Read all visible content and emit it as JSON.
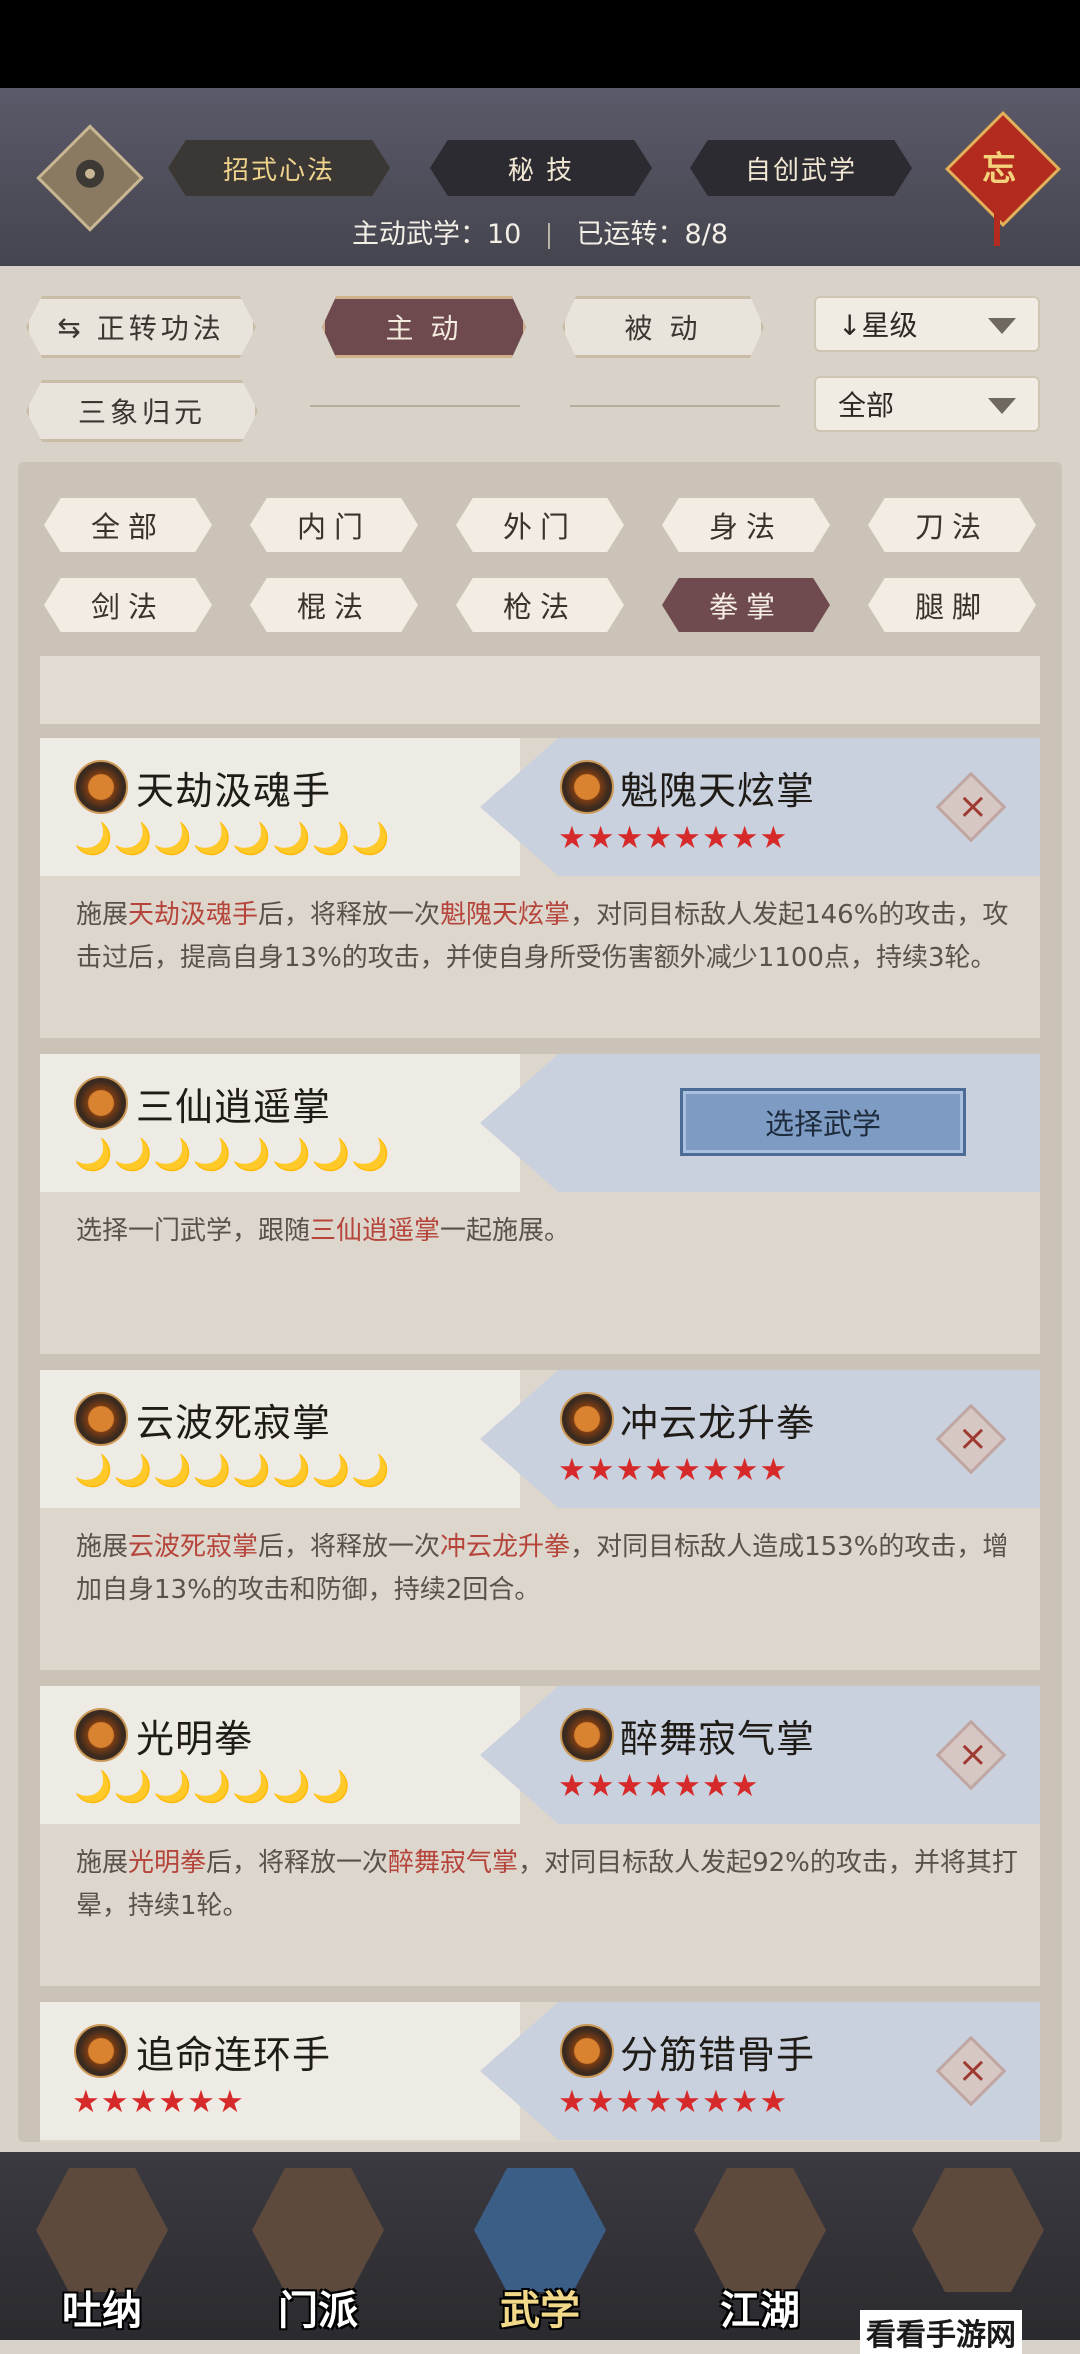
{
  "header": {
    "tabs": [
      {
        "label": "招式心法"
      },
      {
        "label": "秘 技"
      },
      {
        "label": "自创武学"
      }
    ],
    "talisman_char": "忘",
    "active_count_label": "主动武学：10",
    "operated_label": "已运转：8/8"
  },
  "toolbar": {
    "switch_label": "正转功法",
    "active_label": "主 动",
    "passive_label": "被 动",
    "sort_select": "↓星级",
    "sanxiang_label": "三象归元",
    "filter_select": "全部"
  },
  "categories": {
    "row1": [
      "全部",
      "内门",
      "外门",
      "身法",
      "刀法"
    ],
    "row2": [
      "剑法",
      "棍法",
      "枪法",
      "拳掌",
      "腿脚"
    ]
  },
  "cards": [
    {
      "left_name": "天劫汲魂手",
      "left_moons": "🌙🌙🌙🌙🌙🌙🌙🌙",
      "right_name": "魁隗天炫掌",
      "right_stars": "★★★★★★★★",
      "desc_a": "施展",
      "desc_hl1": "天劫汲魂手",
      "desc_b": "后，将释放一次",
      "desc_hl2": "魁隗天炫掌",
      "desc_c": "，对同目标敌人发起146%的攻击，攻击过后，提高自身13%的攻击，并使自身所受伤害额外减少1100点，持续3轮。"
    },
    {
      "left_name": "三仙逍遥掌",
      "left_moons": "🌙🌙🌙🌙🌙🌙🌙🌙",
      "select_label": "选择武学",
      "desc_a": "选择一门武学，跟随",
      "desc_hl1": "三仙逍遥掌",
      "desc_b": "一起施展。"
    },
    {
      "left_name": "云波死寂掌",
      "left_moons": "🌙🌙🌙🌙🌙🌙🌙🌙",
      "right_name": "冲云龙升拳",
      "right_stars": "★★★★★★★★",
      "desc_a": "施展",
      "desc_hl1": "云波死寂掌",
      "desc_b": "后，将释放一次",
      "desc_hl2": "冲云龙升拳",
      "desc_c": "，对同目标敌人造成153%的攻击，增加自身13%的攻击和防御，持续2回合。"
    },
    {
      "left_name": "光明拳",
      "left_moons": "🌙🌙🌙🌙🌙🌙🌙",
      "right_name": "醉舞寂气掌",
      "right_stars": "★★★★★★★",
      "desc_a": "施展",
      "desc_hl1": "光明拳",
      "desc_b": "后，将释放一次",
      "desc_hl2": "醉舞寂气掌",
      "desc_c": "，对同目标敌人发起92%的攻击，并将其打晕，持续1轮。"
    },
    {
      "left_name": "追命连环手",
      "left_stars": "★★★★★★",
      "right_name": "分筋错骨手",
      "right_stars": "★★★★★★★★"
    }
  ],
  "bottom_nav": [
    {
      "label": "吐纳"
    },
    {
      "label": "门派"
    },
    {
      "label": "武学"
    },
    {
      "label": "江湖"
    },
    {
      "label": ""
    }
  ],
  "watermark": "看看手游网",
  "colors": {
    "accent_active": "#6f4b50",
    "highlight_text": "#b5443a",
    "star_red": "#d62a2a",
    "moon_gold": "#e2b83c"
  }
}
